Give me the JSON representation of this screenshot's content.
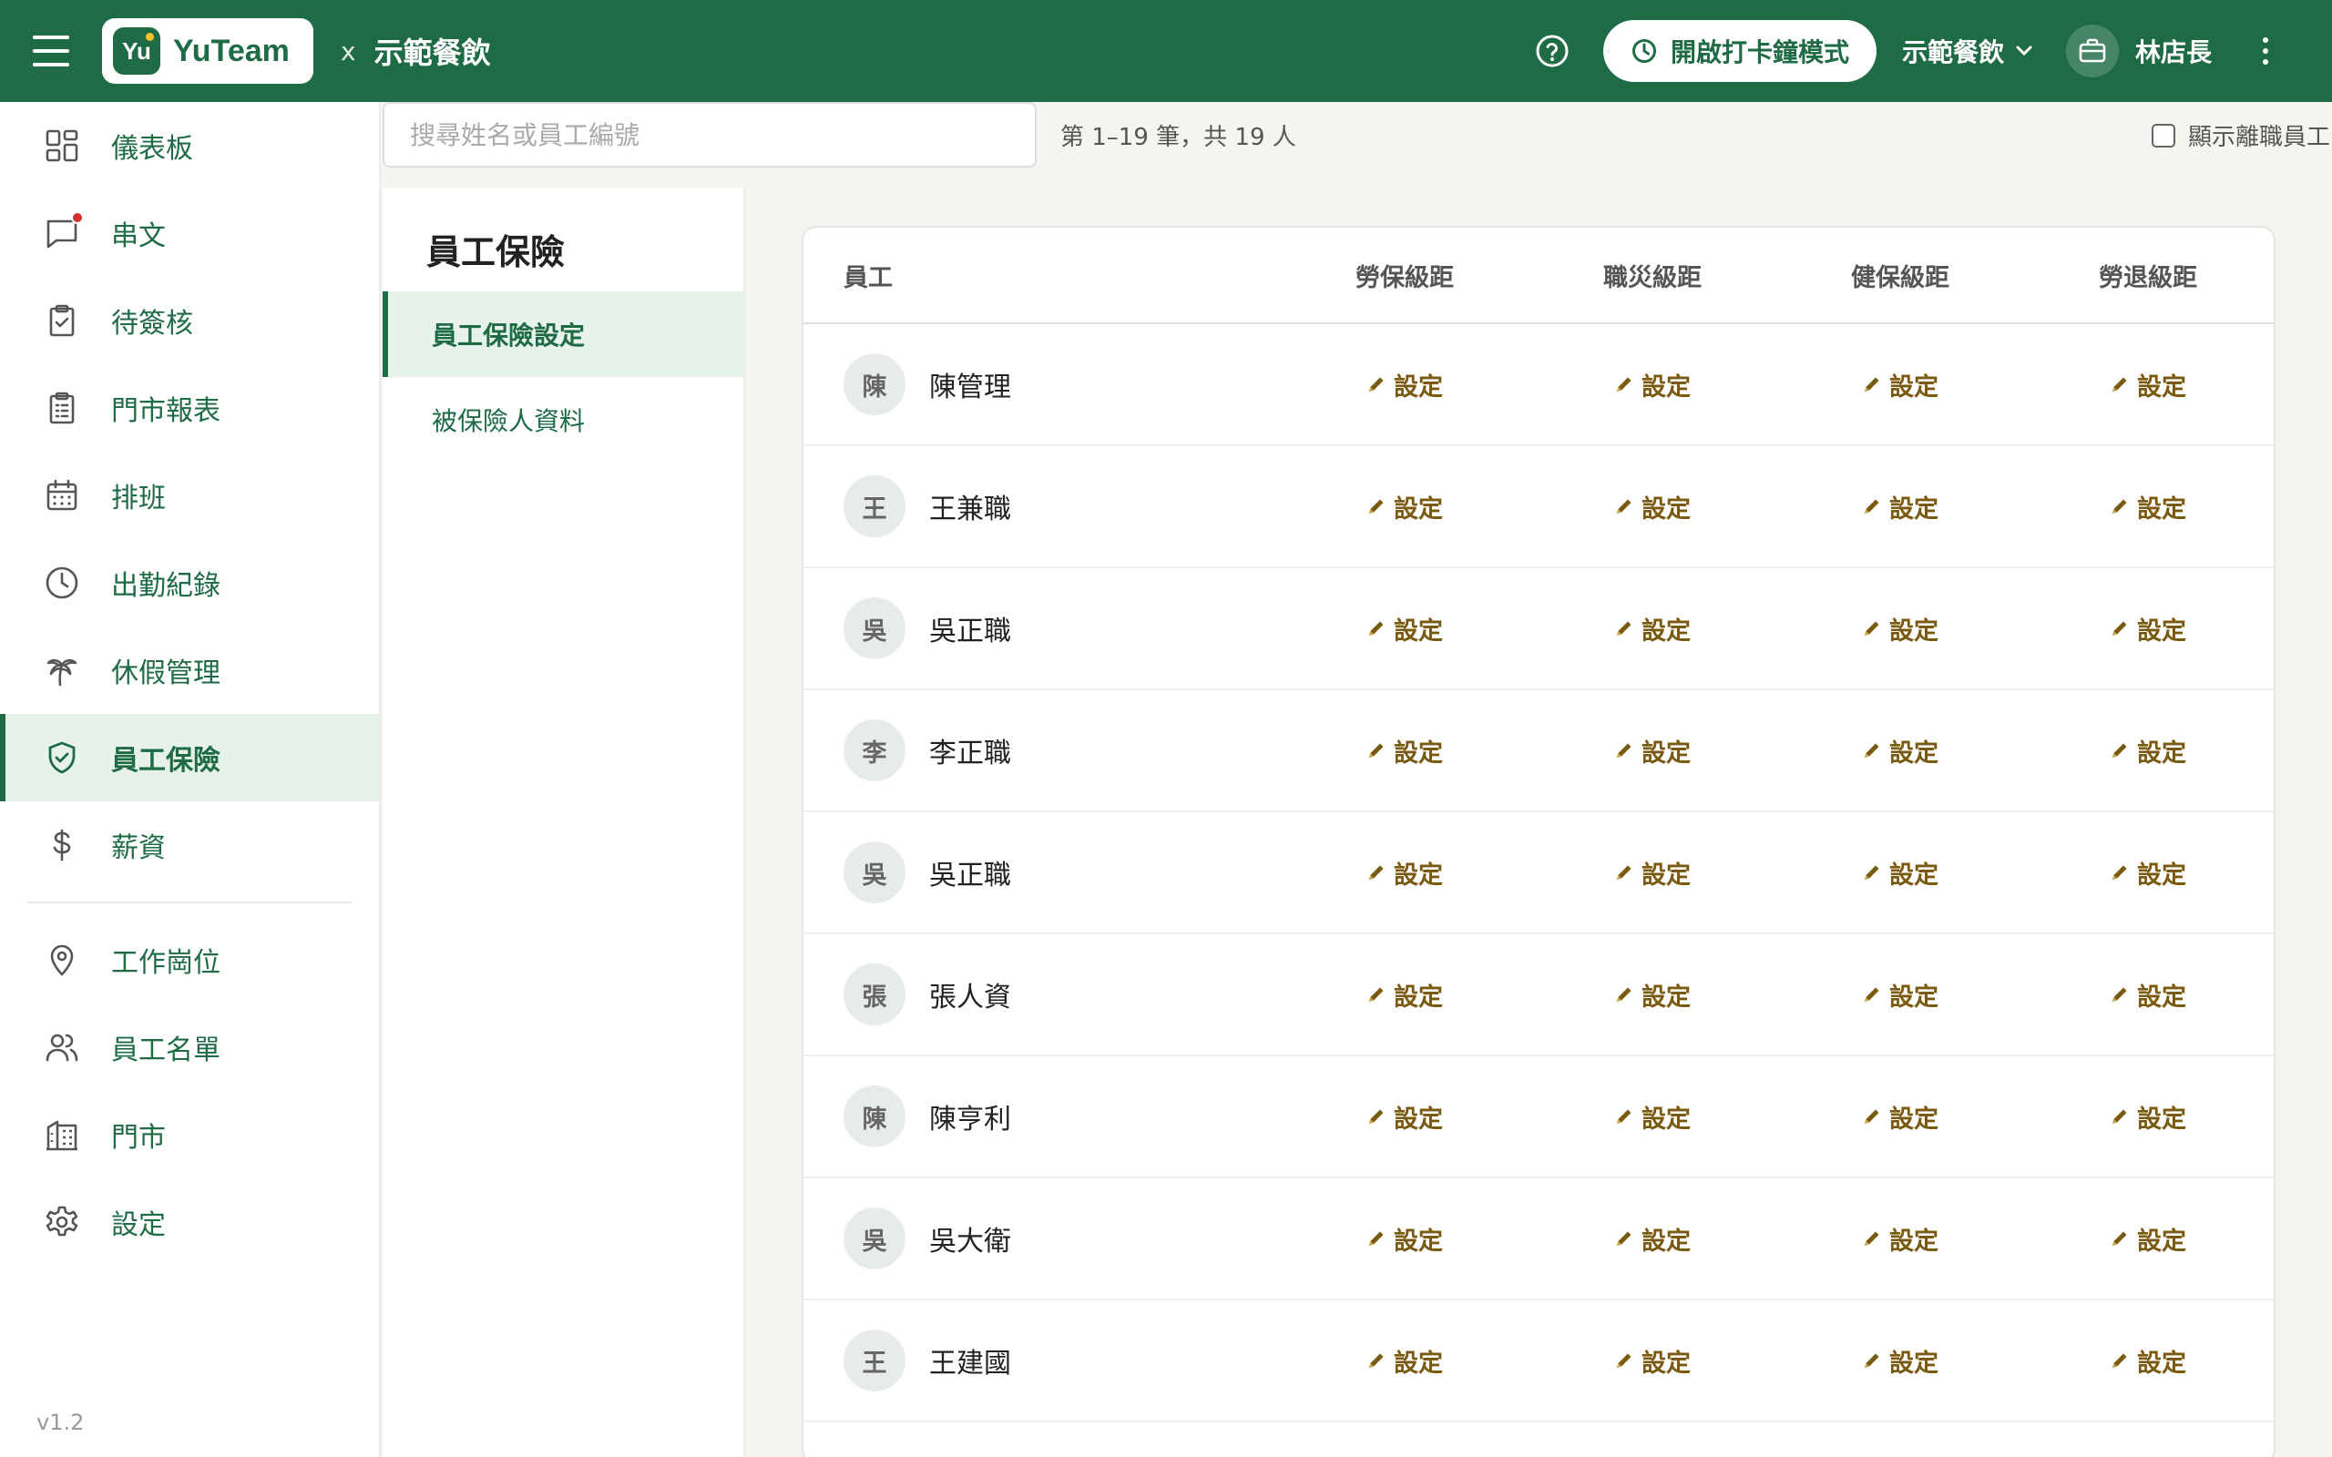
{
  "header": {
    "logo_badge": "Yu",
    "logo_text": "YuTeam",
    "separator": "x",
    "company": "示範餐飲",
    "clock_button": "開啟打卡鐘模式",
    "store_select": "示範餐飲",
    "user_name": "林店長"
  },
  "sidebar": {
    "items": [
      {
        "label": "儀表板",
        "icon": "dashboard-grid-icon"
      },
      {
        "label": "串文",
        "icon": "chat-bubble-icon"
      },
      {
        "label": "待簽核",
        "icon": "clipboard-check-icon"
      },
      {
        "label": "門市報表",
        "icon": "clipboard-list-icon"
      },
      {
        "label": "排班",
        "icon": "calendar-icon"
      },
      {
        "label": "出勤紀錄",
        "icon": "clock-icon"
      },
      {
        "label": "休假管理",
        "icon": "palm-tree-icon"
      },
      {
        "label": "員工保險",
        "icon": "shield-check-icon"
      },
      {
        "label": "薪資",
        "icon": "dollar-icon"
      },
      {
        "label": "工作崗位",
        "icon": "location-pin-icon"
      },
      {
        "label": "員工名單",
        "icon": "users-icon"
      },
      {
        "label": "門市",
        "icon": "building-icon"
      },
      {
        "label": "設定",
        "icon": "gear-icon"
      }
    ],
    "active_index": 7,
    "version": "v1.2"
  },
  "search": {
    "placeholder": "搜尋姓名或員工編號",
    "value": "",
    "count_text": "第 1–19 筆，共 19 人",
    "show_left_label": "顯示離職員工"
  },
  "subnav": {
    "title": "員工保險",
    "items": [
      "員工保險設定",
      "被保險人資料"
    ],
    "active_index": 0
  },
  "table": {
    "headers": [
      "員工",
      "勞保級距",
      "職災級距",
      "健保級距",
      "勞退級距"
    ],
    "set_label": "設定",
    "rows": [
      {
        "avatar": "陳",
        "name": "陳管理"
      },
      {
        "avatar": "王",
        "name": "王兼職"
      },
      {
        "avatar": "吳",
        "name": "吳正職"
      },
      {
        "avatar": "李",
        "name": "李正職"
      },
      {
        "avatar": "吳",
        "name": "吳正職"
      },
      {
        "avatar": "張",
        "name": "張人資"
      },
      {
        "avatar": "陳",
        "name": "陳亨利"
      },
      {
        "avatar": "吳",
        "name": "吳大衛"
      },
      {
        "avatar": "王",
        "name": "王建國"
      }
    ]
  },
  "colors": {
    "brand": "#1e6b45",
    "active_bg": "#e7f3ea",
    "set_link": "#7a5a10",
    "notification": "#d32f2f"
  }
}
